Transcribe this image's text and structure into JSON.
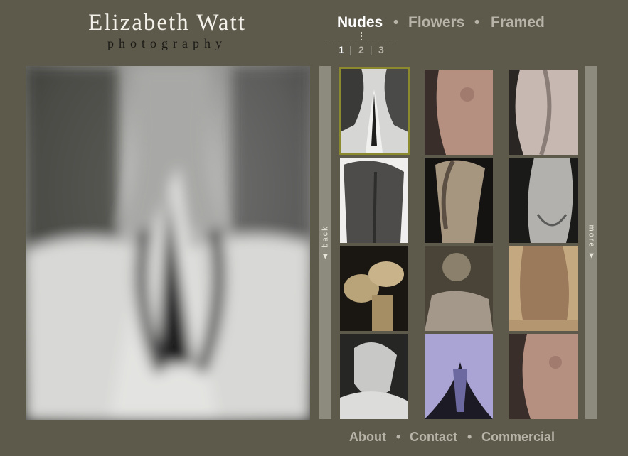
{
  "brand": {
    "name": "Elizabeth Watt",
    "tagline": "photography"
  },
  "categories": [
    {
      "label": "Nudes",
      "active": true
    },
    {
      "label": "Flowers",
      "active": false
    },
    {
      "label": "Framed",
      "active": false
    }
  ],
  "pager": {
    "pages": [
      "1",
      "2",
      "3"
    ],
    "current": "1",
    "sep": "|"
  },
  "scroll": {
    "back_label": "◄ back ",
    "more_label": " more ►"
  },
  "thumbnails": {
    "selected_index": 0,
    "count": 12
  },
  "footer": {
    "links": [
      "About",
      "Contact",
      "Commercial"
    ],
    "sep": "•"
  },
  "colors": {
    "background": "#5d5a4c",
    "selection": "#8b8a2f",
    "nav_inactive": "#b8b5a8"
  }
}
